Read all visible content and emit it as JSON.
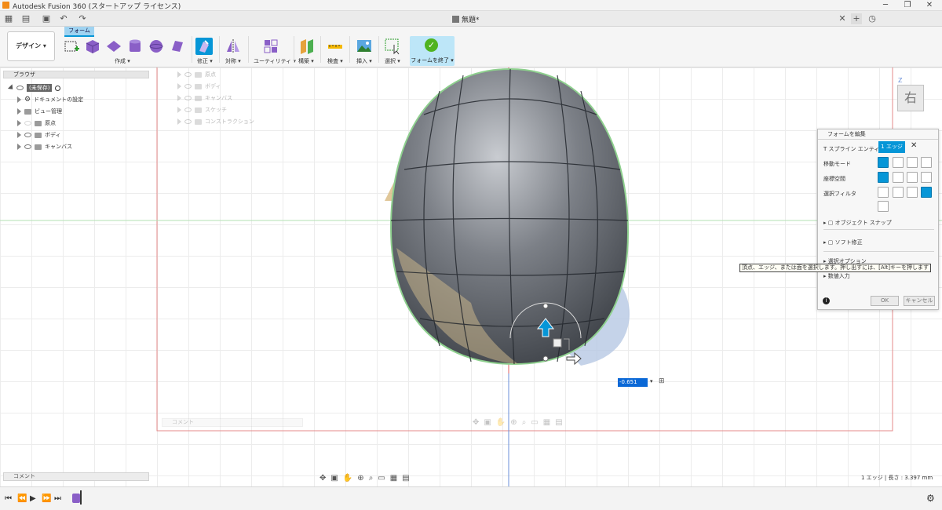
{
  "app": {
    "title": "Autodesk Fusion 360 (スタートアップ ライセンス)"
  },
  "doc_tab": {
    "title": "無題*"
  },
  "workspace": {
    "label": "デザイン ▾"
  },
  "ribbon": {
    "active_tab": "フォーム",
    "groups": {
      "create": "作成 ▾",
      "modify": "修正 ▾",
      "symmetry": "対称 ▾",
      "utilities": "ユーティリティ ▾",
      "construct": "構築 ▾",
      "inspect": "検査 ▾",
      "insert": "挿入 ▾",
      "select": "選択 ▾",
      "finish": "フォームを終了 ▾"
    }
  },
  "browser": {
    "title": "ブラウザ",
    "root": "(未保存)",
    "items": [
      "ドキュメントの設定",
      "ビュー管理",
      "原点",
      "ボディ",
      "キャンバス"
    ],
    "ghost_items": [
      "原点",
      "ボディ",
      "キャンバス",
      "スケッチ",
      "コンストラクション"
    ]
  },
  "comments": {
    "label": "コメント",
    "ghost_label": "コメント"
  },
  "edit_form": {
    "title": "フォームを編集",
    "tspline_label": "T スプライン エンティティ",
    "tspline_value": "1 エッジ",
    "move_mode": "移動モード",
    "coord_space": "座標空間",
    "select_filter": "選択フィルタ",
    "object_snap": "オブジェクト スナップ",
    "soft_modify": "ソフト修正",
    "select_options": "選択オプション",
    "numeric_input": "数値入力",
    "ok": "OK",
    "cancel": "キャンセル"
  },
  "tooltip": {
    "text": "頂点、エッジ、または面を選択します。押し出すには、[Alt]キーを押します"
  },
  "viewcube": {
    "face": "右",
    "axis": "Z"
  },
  "input": {
    "value": "-0.651 mm"
  },
  "status": {
    "text": "1 エッジ | 長さ : 3.397 mm"
  },
  "colors": {
    "accent": "#0696d7",
    "finish_check": "#4fb320",
    "axis_red": "#e06060",
    "mesh": "#5a5f66"
  }
}
